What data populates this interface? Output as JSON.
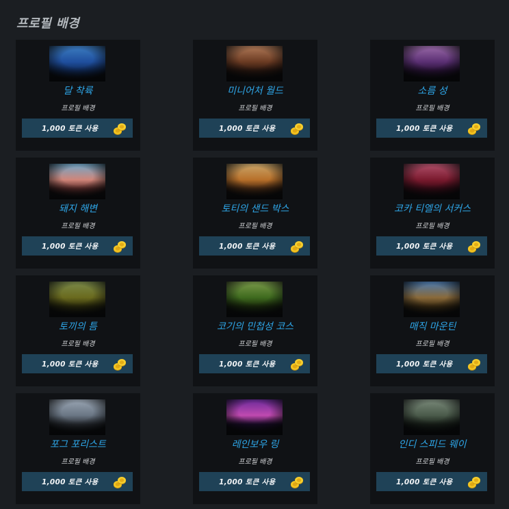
{
  "page": {
    "title": "프로필 배경"
  },
  "items": [
    {
      "name": "달 착륙",
      "kind": "프로필 배경",
      "price_label": "1,000 토큰 사용",
      "colors": [
        "#3c7cc0",
        "#1f4f9e",
        "#0f2a5a"
      ]
    },
    {
      "name": "미니어처 월드",
      "kind": "프로필 배경",
      "price_label": "1,000 토큰 사용",
      "colors": [
        "#b07a58",
        "#6a3a22",
        "#2a160e"
      ]
    },
    {
      "name": "소름 성",
      "kind": "프로필 배경",
      "price_label": "1,000 토큰 사용",
      "colors": [
        "#9a6aa8",
        "#5a2f73",
        "#2a1238"
      ]
    },
    {
      "name": "돼지 해변",
      "kind": "프로필 배경",
      "price_label": "1,000 토큰 사용",
      "colors": [
        "#6fa7c9",
        "#d0867a",
        "#5a2a28"
      ]
    },
    {
      "name": "토티의 샌드 박스",
      "kind": "프로필 배경",
      "price_label": "1,000 토큰 사용",
      "colors": [
        "#c9a66a",
        "#b8702a",
        "#4a2a12"
      ]
    },
    {
      "name": "코카 티엘의 서커스",
      "kind": "프로필 배경",
      "price_label": "1,000 토큰 사용",
      "colors": [
        "#b0506a",
        "#7a1a2e",
        "#3a0a16"
      ]
    },
    {
      "name": "토끼의 틈",
      "kind": "프로필 배경",
      "price_label": "1,000 토큰 사용",
      "colors": [
        "#7a8a4a",
        "#6a6a1e",
        "#2a2a0a"
      ]
    },
    {
      "name": "코기의 민첩성 코스",
      "kind": "프로필 배경",
      "price_label": "1,000 토큰 사용",
      "colors": [
        "#7a9a4a",
        "#3e6a1e",
        "#1a2a0a"
      ]
    },
    {
      "name": "매직 마운틴",
      "kind": "프로필 배경",
      "price_label": "1,000 토큰 사용",
      "colors": [
        "#4a7ab0",
        "#8a6a3a",
        "#3a2a10"
      ]
    },
    {
      "name": "포그 포리스트",
      "kind": "프로필 배경",
      "price_label": "1,000 토큰 사용",
      "colors": [
        "#9aa6b4",
        "#6a7684",
        "#2a2e34"
      ]
    },
    {
      "name": "레인보우 링",
      "kind": "프로필 배경",
      "price_label": "1,000 토큰 사용",
      "colors": [
        "#6a2a9a",
        "#c04ab0",
        "#1a0a2a"
      ]
    },
    {
      "name": "인디 스피드 웨이",
      "kind": "프로필 배경",
      "price_label": "1,000 토큰 사용",
      "colors": [
        "#7a8a7a",
        "#4a5a4a",
        "#1a221a"
      ]
    }
  ],
  "icons": {
    "coin": "coin-stack-icon",
    "coin_color": "#f0c020"
  }
}
